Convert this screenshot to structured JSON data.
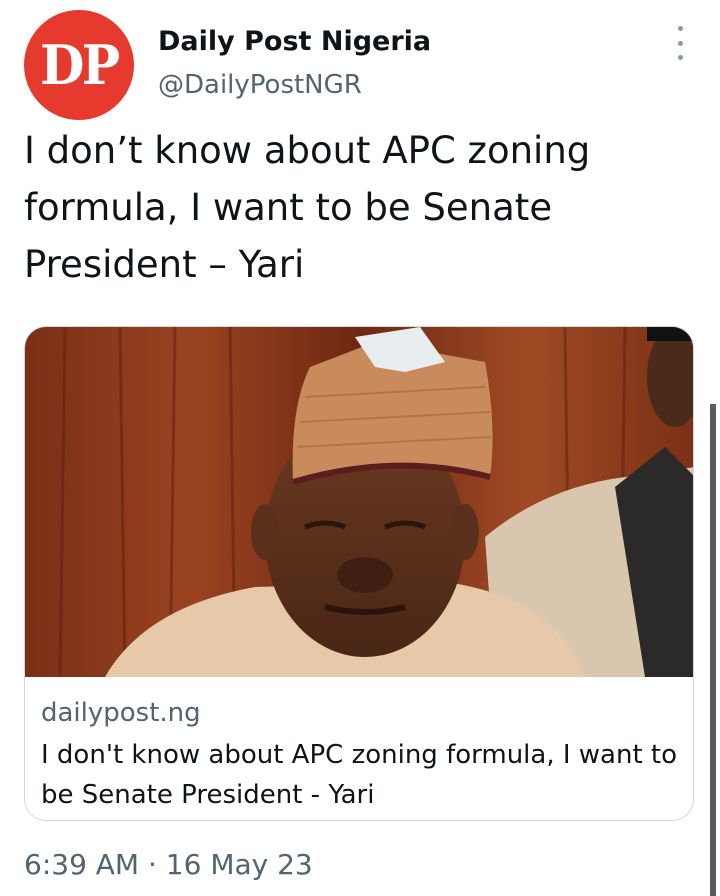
{
  "author": {
    "avatar_text": "DP",
    "name": "Daily Post Nigeria",
    "handle": "@DailyPostNGR"
  },
  "tweet": {
    "text": "I don’t know about APC zoning formula, I want to be Senate President – Yari",
    "timestamp": "6:39 AM · 16 May 23"
  },
  "card": {
    "domain": "dailypost.ng",
    "title": "I don't know about APC zoning formula, I want to be Senate President - Yari"
  },
  "icons": {
    "more": "more-vertical-icon"
  },
  "colors": {
    "avatar_bg": "#e63a2e",
    "secondary_text": "#536471",
    "card_border": "#cfd9de"
  }
}
